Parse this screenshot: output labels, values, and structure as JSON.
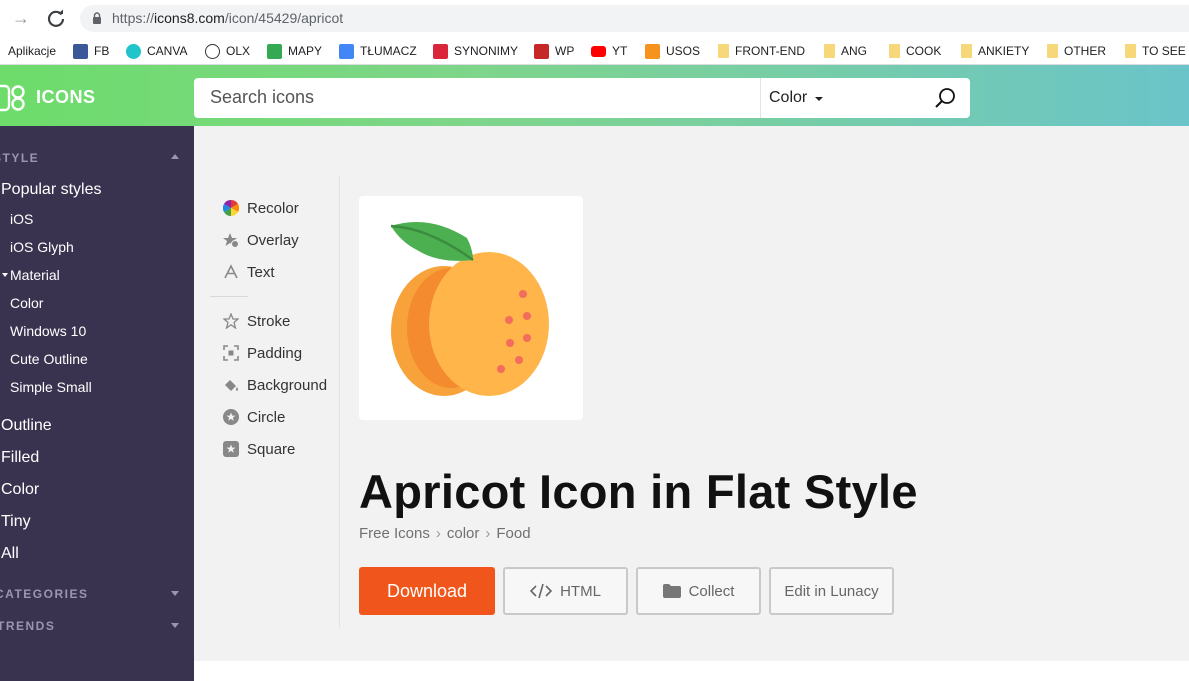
{
  "browser": {
    "url_prefix": "https://",
    "url_host": "icons8.com",
    "url_path": "/icon/45429/apricot",
    "bookmarks": [
      {
        "label": "Aplikacje",
        "icon": "apps-grid-icon",
        "color": "#4285f4"
      },
      {
        "label": "FB",
        "icon": "facebook-icon",
        "color": "#3b5998"
      },
      {
        "label": "CANVA",
        "icon": "canva-icon",
        "color": "#20c4cb"
      },
      {
        "label": "OLX",
        "icon": "olx-icon",
        "color": "#ffffff"
      },
      {
        "label": "MAPY",
        "icon": "maps-icon",
        "color": "#34a853"
      },
      {
        "label": "TŁUMACZ",
        "icon": "translate-icon",
        "color": "#4285f4"
      },
      {
        "label": "SYNONIMY",
        "icon": "synonimy-icon",
        "color": "#d9263a"
      },
      {
        "label": "WP",
        "icon": "wp-icon",
        "color": "#c62828"
      },
      {
        "label": "YT",
        "icon": "youtube-icon",
        "color": "#ff0000"
      },
      {
        "label": "USOS",
        "icon": "usos-icon",
        "color": "#f6921e"
      },
      {
        "label": "FRONT-END",
        "icon": "folder-icon"
      },
      {
        "label": "ANG",
        "icon": "folder-icon"
      },
      {
        "label": "COOK",
        "icon": "folder-icon"
      },
      {
        "label": "ANKIETY",
        "icon": "folder-icon"
      },
      {
        "label": "OTHER",
        "icon": "folder-icon"
      },
      {
        "label": "TO SEE",
        "icon": "folder-icon"
      }
    ]
  },
  "header": {
    "logo_text": "ICONS",
    "search_placeholder": "Search icons",
    "style_filter": "Color"
  },
  "sidebar": {
    "style_section": "STYLE",
    "popular_label": "Popular styles",
    "popular_items": [
      "iOS",
      "iOS Glyph",
      "Material",
      "Color",
      "Windows 10",
      "Cute Outline",
      "Simple Small"
    ],
    "main_items": [
      "Outline",
      "Filled",
      "Color",
      "Tiny",
      "All"
    ],
    "categories_section": "CATEGORIES",
    "trends_section": "TRENDS"
  },
  "tools": {
    "recolor": "Recolor",
    "overlay": "Overlay",
    "text": "Text",
    "stroke": "Stroke",
    "padding": "Padding",
    "background": "Background",
    "circle": "Circle",
    "square": "Square"
  },
  "icon_page": {
    "title": "Apricot Icon in Flat Style",
    "breadcrumbs": [
      "Free Icons",
      "color",
      "Food"
    ],
    "download_label": "Download",
    "html_label": "HTML",
    "collect_label": "Collect",
    "lunacy_label": "Edit in Lunacy"
  },
  "colors": {
    "accent": "#f0561b",
    "sidebar_bg": "#3a3350",
    "header_gradient_start": "#6ddc6a",
    "header_gradient_end": "#6bc4c9"
  }
}
